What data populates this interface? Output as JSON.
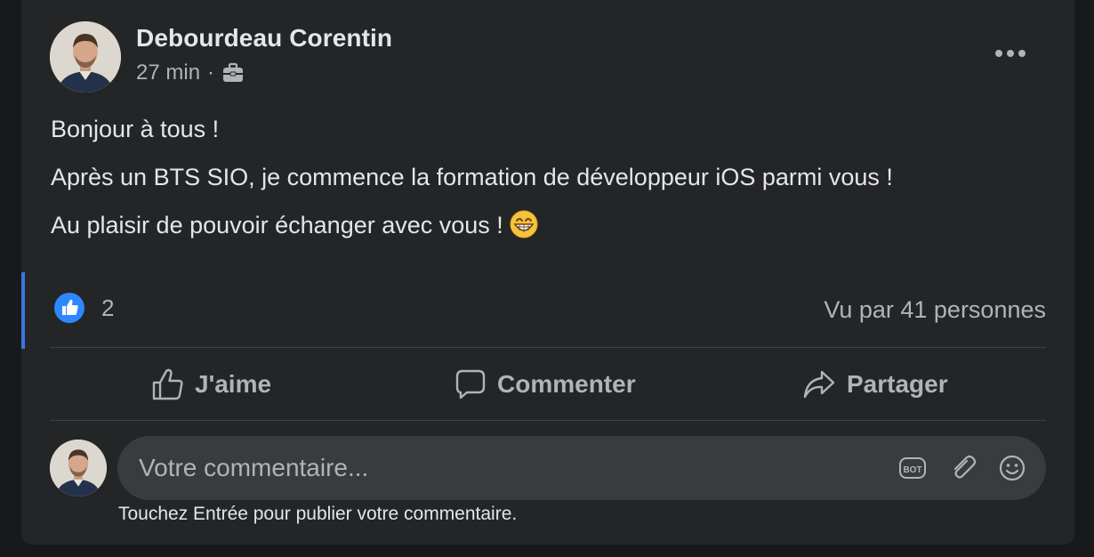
{
  "post": {
    "author": "Debourdeau Corentin",
    "time": "27 min",
    "separator": "·",
    "privacy_icon": "briefcase-icon",
    "more_icon": "more-horizontal-icon",
    "body": [
      "Bonjour à tous !",
      "Après un BTS SIO, je commence la formation de développeur iOS parmi vous !",
      "Au plaisir de pouvoir échanger avec vous !"
    ],
    "emoji": "grinning-face-emoji"
  },
  "reactions": {
    "icon": "like-badge-icon",
    "count": "2",
    "seen_by": "Vu par 41 personnes"
  },
  "actions": {
    "like_label": "J'aime",
    "comment_label": "Commenter",
    "share_label": "Partager"
  },
  "comment": {
    "placeholder": "Votre commentaire...",
    "value": "",
    "hint": "Touchez Entrée pour publier votre commentaire.",
    "icons": [
      "bot-icon",
      "paperclip-icon",
      "smiley-icon"
    ]
  },
  "colors": {
    "background": "#18191a",
    "card": "#242526",
    "accent": "#3578e5",
    "text_primary": "#e4e6eb",
    "text_secondary": "#b0b3b8",
    "input_bg": "#3a3b3c"
  }
}
